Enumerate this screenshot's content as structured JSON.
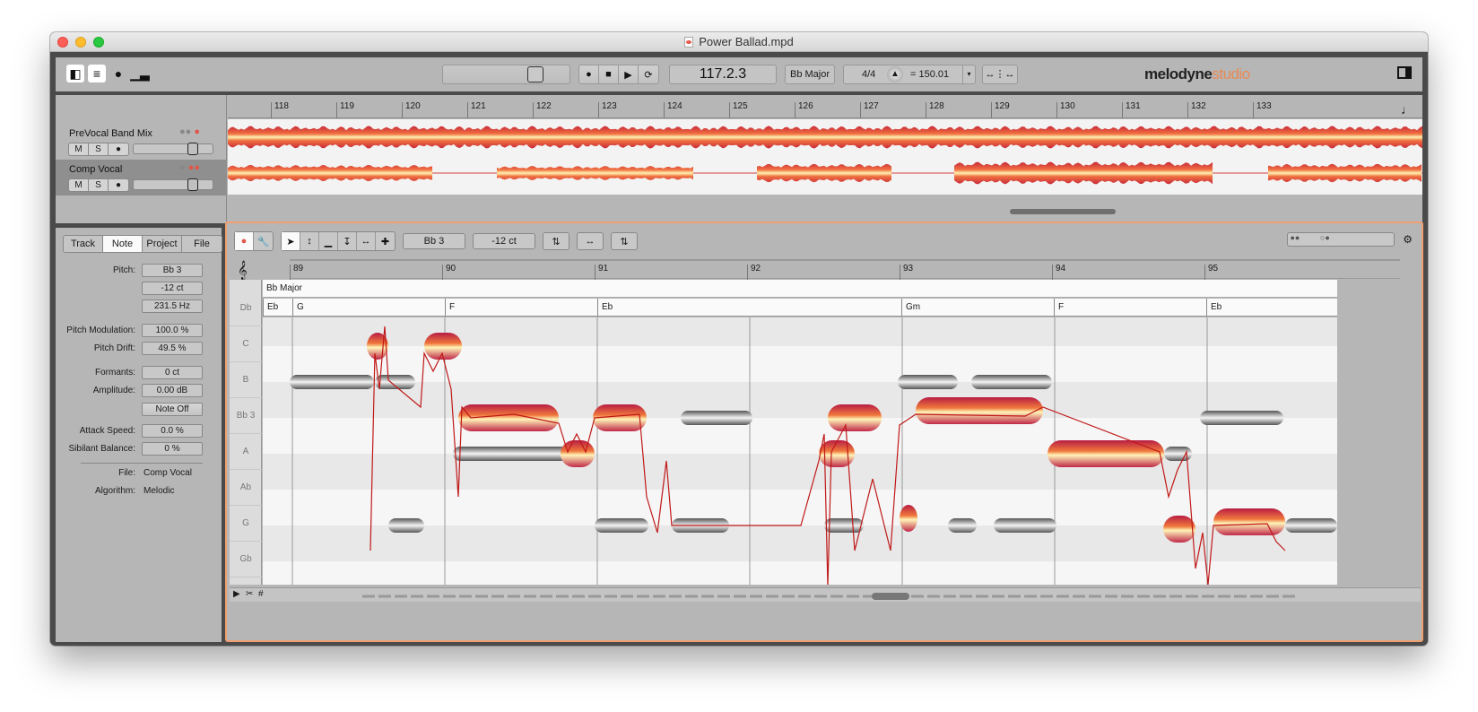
{
  "window": {
    "title": "Power Ballad.mpd",
    "traffic_lights": [
      "close",
      "minimize",
      "zoom"
    ]
  },
  "toolbar": {
    "view_icons": [
      "inspector-toggle-icon",
      "mixer-icon",
      "blobs-icon",
      "spectrum-icon"
    ],
    "transport": [
      "record-icon",
      "stop-icon",
      "play-icon",
      "cycle-icon"
    ],
    "position": "117.2.3",
    "key": "Bb Major",
    "time_signature": "4/4",
    "tempo": "= 150.01",
    "brand_main": "melodyne",
    "brand_sub": "studio"
  },
  "arrange": {
    "ruler_bars": [
      "118",
      "119",
      "120",
      "121",
      "122",
      "123",
      "124",
      "125",
      "126",
      "127",
      "128",
      "129",
      "130",
      "131",
      "132",
      "133"
    ],
    "tracks": [
      {
        "name": "PreVocal Band Mix",
        "mute": "M",
        "solo": "S",
        "selected": false
      },
      {
        "name": "Comp Vocal",
        "mute": "M",
        "solo": "S",
        "selected": true
      }
    ]
  },
  "inspector": {
    "tabs": [
      "Track",
      "Note",
      "Project",
      "File"
    ],
    "active_tab": "Note",
    "properties": [
      {
        "label": "Pitch:",
        "value": "Bb 3"
      },
      {
        "label": "",
        "value": "-12 ct"
      },
      {
        "label": "",
        "value": "231.5 Hz"
      },
      {
        "label": "Pitch Modulation:",
        "value": "100.0 %"
      },
      {
        "label": "Pitch Drift:",
        "value": "49.5 %"
      },
      {
        "label": "Formants:",
        "value": "0 ct"
      },
      {
        "label": "Amplitude:",
        "value": "0.00 dB"
      },
      {
        "label": "",
        "value": "Note Off"
      },
      {
        "label": "Attack Speed:",
        "value": "0.0 %"
      },
      {
        "label": "Sibilant Balance:",
        "value": "0 %"
      }
    ],
    "file_label": "File:",
    "file_value": "Comp Vocal",
    "algorithm_label": "Algorithm:",
    "algorithm_value": "Melodic"
  },
  "editor": {
    "pitch_field": "Bb 3",
    "cents_field": "-12 ct",
    "ruler_bars": [
      "89",
      "90",
      "91",
      "92",
      "93",
      "94",
      "95"
    ],
    "key_lane": "Bb Major",
    "chords": [
      "Eb",
      "G",
      "F",
      "Eb",
      "Gm",
      "F",
      "Eb"
    ],
    "pitch_rows": [
      "Db",
      "C",
      "B",
      "Bb 3",
      "A",
      "Ab",
      "G",
      "Gb"
    ]
  }
}
